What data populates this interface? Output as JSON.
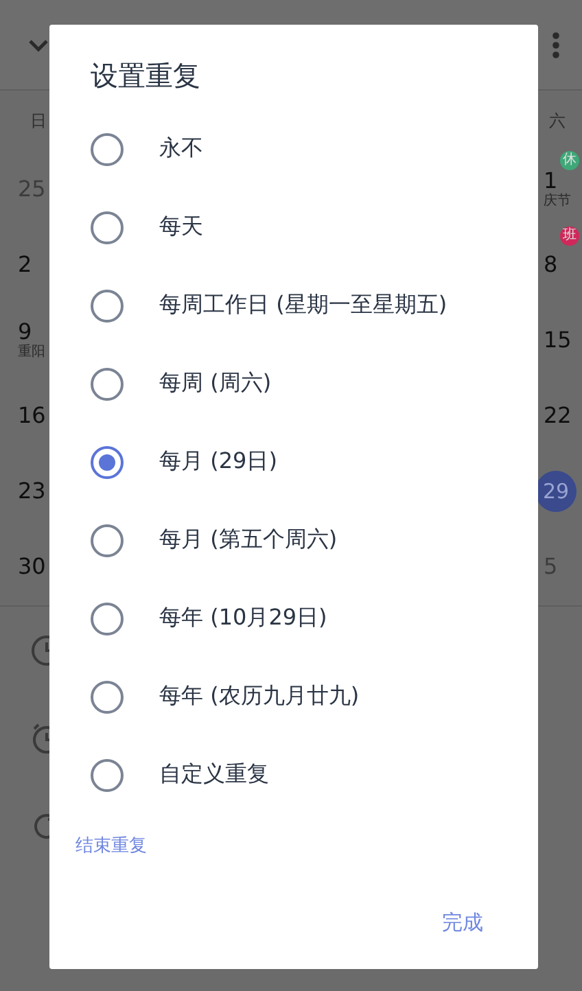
{
  "weekdays": [
    "日",
    "六"
  ],
  "left_days": [
    {
      "day": "25",
      "faded": true
    },
    {
      "day": "2",
      "faded": false
    },
    {
      "day": "9",
      "faded": false,
      "note": "重阳"
    },
    {
      "day": "16",
      "faded": false
    },
    {
      "day": "23",
      "faded": false
    },
    {
      "day": "30",
      "faded": false
    }
  ],
  "right_days": [
    {
      "day": "1",
      "faded": false,
      "selected": false,
      "note": "庆节",
      "badge": "休",
      "color": "#3fa878"
    },
    {
      "day": "8",
      "faded": false,
      "selected": false,
      "badge": "班",
      "color": "#d0285a"
    },
    {
      "day": "15",
      "faded": false,
      "selected": false
    },
    {
      "day": "22",
      "faded": false,
      "selected": false
    },
    {
      "day": "29",
      "faded": false,
      "selected": true
    },
    {
      "day": "5",
      "faded": true,
      "selected": false
    }
  ],
  "dialog": {
    "title": "设置重复",
    "options": [
      {
        "label": "永不",
        "selected": false
      },
      {
        "label": "每天",
        "selected": false
      },
      {
        "label": "每周工作日 (星期一至星期五)",
        "selected": false
      },
      {
        "label": "每周 (周六)",
        "selected": false
      },
      {
        "label": "每月 (29日)",
        "selected": true
      },
      {
        "label": "每月 (第五个周六)",
        "selected": false
      },
      {
        "label": "每年 (10月29日)",
        "selected": false
      },
      {
        "label": "每年 (农历九月廿九)",
        "selected": false
      },
      {
        "label": "自定义重复",
        "selected": false
      }
    ],
    "end_link": "结束重复",
    "done_button": "完成"
  }
}
